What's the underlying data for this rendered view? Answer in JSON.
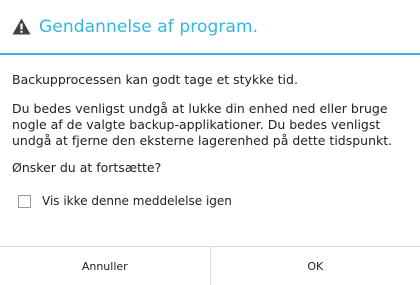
{
  "dialog": {
    "title": "Gendannelse af program.",
    "icon": "warning-icon",
    "accent_color": "#33b5e5",
    "paragraphs": [
      "Backupprocessen kan godt tage et stykke tid.",
      "Du bedes venligst undgå at lukke din enhed ned eller bruge nogle af de valgte backup-applikationer. Du bedes venligst undgå at fjerne den eksterne lagerenhed på dette tidspunkt.",
      "Ønsker du at fortsætte?"
    ],
    "checkbox": {
      "label": "Vis ikke denne meddelelse igen",
      "checked": false
    },
    "buttons": {
      "cancel_label": "Annuller",
      "ok_label": "OK"
    }
  }
}
